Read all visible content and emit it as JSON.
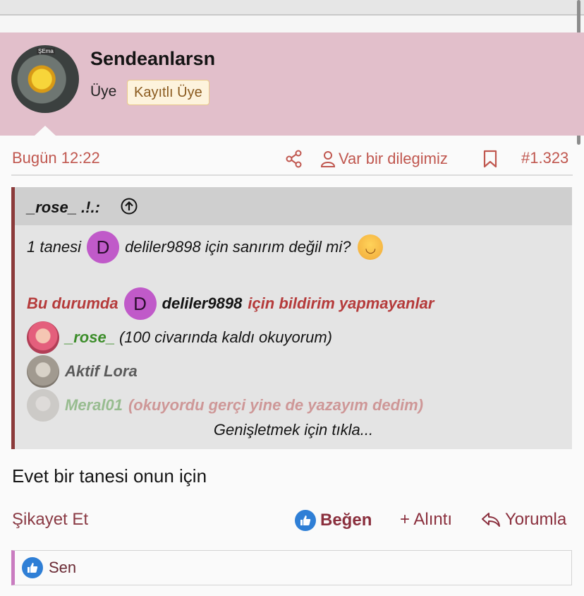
{
  "post": {
    "username": "Sendeanlarsn",
    "role": "Üye",
    "badge": "Kayıtlı Üye",
    "avatar_caption": "ŞEma",
    "date": "Bugün 12:22",
    "author_link": "Var bir dilegimiz",
    "post_number": "#1.323",
    "body": "Evet bir tanesi onun için"
  },
  "quote": {
    "author": "_rose_ .!.:",
    "line1_before": "1 tanesi",
    "line1_mention_initial": "D",
    "line1_after": "deliler9898 için sanırım değil mi?",
    "line2_prefix": "Bu durumda",
    "line2_mention_initial": "D",
    "line2_name": "deliler9898",
    "line2_suffix": "için bildirim yapmayanlar",
    "users": [
      {
        "name": "_rose_",
        "note": "(100 civarında kaldı okuyorum)"
      },
      {
        "name": "Aktif Lora",
        "note": ""
      },
      {
        "name": "Meral01",
        "note": "(okuyordu gerçi yine de yazayım dedim)"
      }
    ],
    "expand": "Genişletmek için tıkla..."
  },
  "actions": {
    "report": "Şikayet Et",
    "like": "Beğen",
    "quote": "+ Alıntı",
    "reply": "Yorumla"
  },
  "likes": {
    "text": "Sen"
  },
  "colors": {
    "user_header_bg": "#e2bfcb",
    "meta_accent": "#c0574f",
    "quote_border": "#8b3a3a",
    "mention_bg": "#c05ac9",
    "like_blue": "#2f7fd6"
  }
}
